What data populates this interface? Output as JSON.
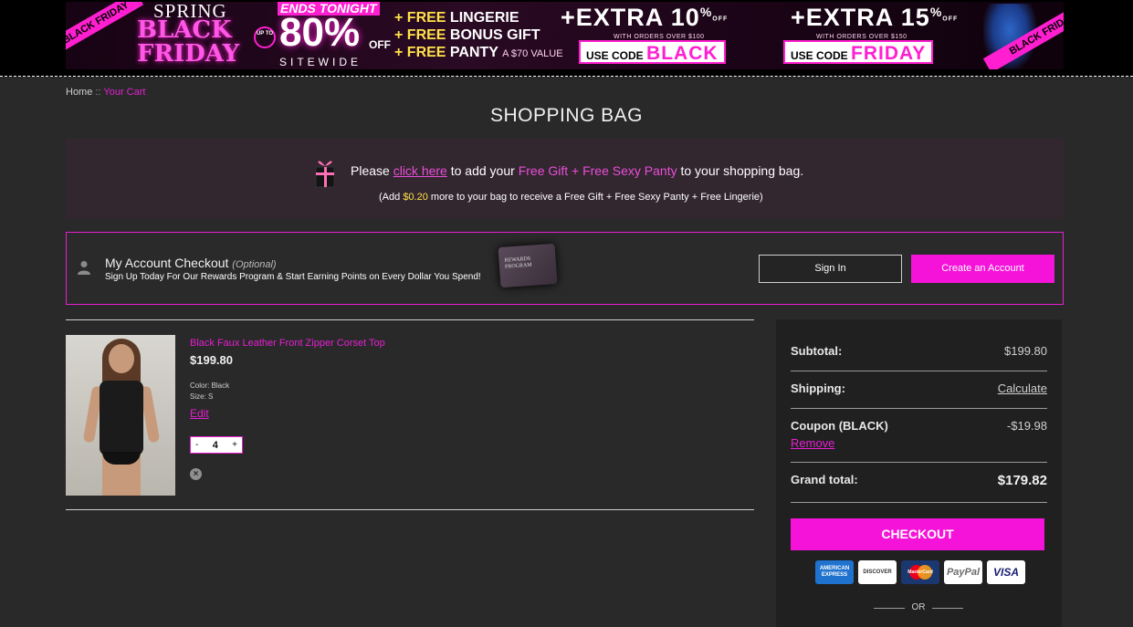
{
  "banner": {
    "ribbon": "BLACK FRIDAY",
    "spring": "SPRING",
    "title_line1": "BLACK",
    "title_line2": "FRIDAY",
    "up_to": "UP TO",
    "ends_tonight": "ENDS TONIGHT",
    "percent": "80%",
    "off": "OFF",
    "sitewide": "SITEWIDE",
    "free_items": [
      {
        "prefix": "+ FREE",
        "item": "LINGERIE",
        "extra": ""
      },
      {
        "prefix": "+ FREE",
        "item": "BONUS GIFT",
        "extra": ""
      },
      {
        "prefix": "+ FREE",
        "item": "PANTY",
        "extra": "A $70 VALUE"
      }
    ],
    "offers": [
      {
        "headline": "+EXTRA 10",
        "pct": "%",
        "off": "OFF",
        "condition": "WITH ORDERS OVER $100",
        "use_code": "USE CODE",
        "code": "BLACK"
      },
      {
        "headline": "+EXTRA 15",
        "pct": "%",
        "off": "OFF",
        "condition": "WITH ORDERS OVER $150",
        "use_code": "USE CODE",
        "code": "FRIDAY"
      }
    ],
    "accent": "#ff1fd0"
  },
  "breadcrumb": {
    "home": "Home",
    "sep": "::",
    "current": "Your Cart"
  },
  "page_title": "SHOPPING BAG",
  "gift_notice": {
    "please": "Please",
    "link": "click here",
    "middle": "to add your",
    "highlight": "Free Gift + Free Sexy Panty",
    "end": "to your shopping bag.",
    "sub_pre": "(Add",
    "sub_amount": "$0.20",
    "sub_post": "more to your bag to receive a Free Gift + Free Sexy Panty + Free Lingerie)"
  },
  "account": {
    "title": "My Account Checkout",
    "optional": "(Optional)",
    "subtitle": "Sign Up Today For Our Rewards Program & Start Earning Points on Every Dollar You Spend!",
    "rewards_card": "REWARDS PROGRAM",
    "signin": "Sign In",
    "create": "Create an Account"
  },
  "cart_item": {
    "name": "Black Faux Leather Front Zipper Corset Top",
    "price": "$199.80",
    "color": "Color:  Black",
    "size": "Size:  S",
    "edit": "Edit",
    "qty_minus": "-",
    "qty": "4",
    "qty_plus": "+",
    "remove_icon": "×"
  },
  "summary": {
    "subtotal_label": "Subtotal:",
    "subtotal_value": "$199.80",
    "shipping_label": "Shipping:",
    "shipping_value": "Calculate",
    "coupon_label": "Coupon (BLACK)",
    "coupon_value": "-$19.98",
    "coupon_remove": "Remove",
    "grand_label": "Grand total:",
    "grand_value": "$179.82",
    "checkout": "CHECKOUT",
    "cards": {
      "amex": "AMERICAN EXPRESS",
      "discover": "DISCOVER",
      "mastercard": "MasterCard",
      "paypal": "PayPal",
      "visa": "VISA"
    },
    "or": "OR"
  },
  "colors": {
    "accent": "#f513d9",
    "bg": "#292929",
    "panel": "#202020"
  }
}
